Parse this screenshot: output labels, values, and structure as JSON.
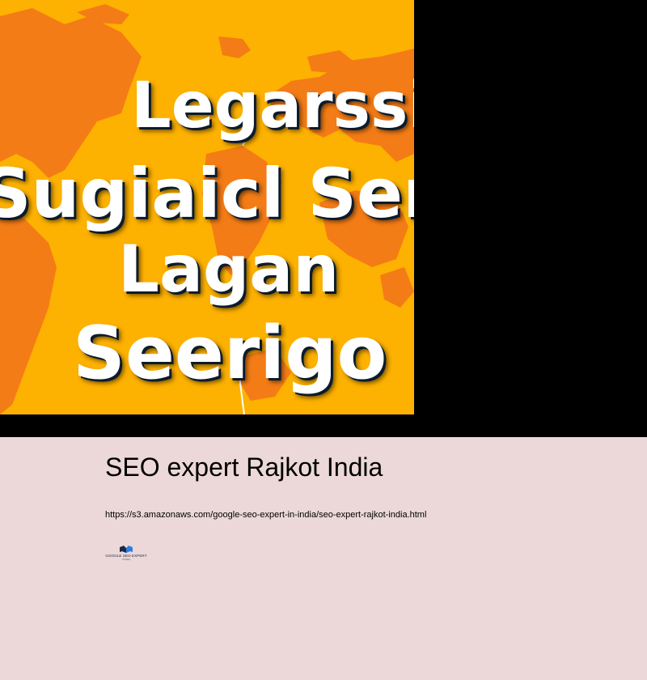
{
  "hero": {
    "lines": [
      "Legarssi",
      "Sugiaicl Seroi",
      "Lagan",
      "Seerigo"
    ],
    "colors": {
      "background": "#fdb100",
      "map": "#f47c16",
      "text": "#ffffff",
      "shadow": "#0d1b2a"
    }
  },
  "article": {
    "title": "SEO expert Rajkot India",
    "url": "https://s3.amazonaws.com/google-seo-expert-in-india/seo-expert-rajkot-india.html"
  },
  "logo": {
    "name": "GOOGLE SEO EXPERT",
    "subtitle": "IN INDIA",
    "colors": {
      "mark_dark": "#1a2a44",
      "mark_blue": "#2b7de9"
    }
  },
  "page": {
    "background": "#ecd8d8"
  }
}
